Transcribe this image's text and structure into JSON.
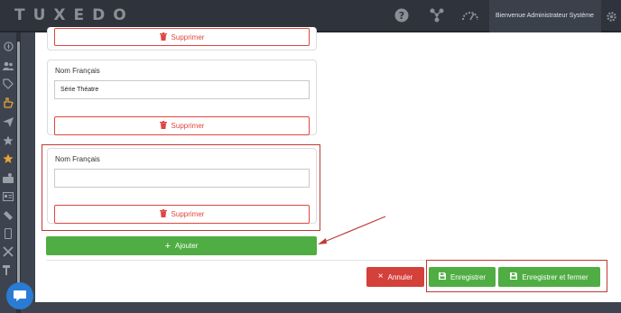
{
  "app": {
    "logo": "TUXEDO",
    "welcome": "Bienvenue Administrateur Système"
  },
  "topbar": {
    "icons": [
      "help-icon",
      "network-icon",
      "gauge-icon",
      "gear-icon"
    ]
  },
  "sidebar": {
    "icons": [
      "compass-icon",
      "users-icon",
      "tags-icon",
      "hand-icon",
      "send-icon",
      "star-icon",
      "star-active-icon",
      "briefcase-icon",
      "id-card-icon",
      "ticket-icon",
      "phone-icon",
      "tools-icon",
      "hammer-icon"
    ]
  },
  "form": {
    "cards": [
      {
        "label": "",
        "value": "",
        "delete_label": "Supprimer"
      },
      {
        "label": "Nom Français",
        "value": "Série Théatre",
        "delete_label": "Supprimer"
      },
      {
        "label": "Nom Français",
        "value": "",
        "delete_label": "Supprimer"
      }
    ],
    "add_label": "Ajouter"
  },
  "actions": {
    "cancel": "Annuler",
    "save": "Enregistrer",
    "save_close": "Enregistrer et fermer"
  },
  "colors": {
    "accent_green": "#4fad43",
    "danger_red": "#e0463f",
    "annotation_red": "#c03a36"
  }
}
